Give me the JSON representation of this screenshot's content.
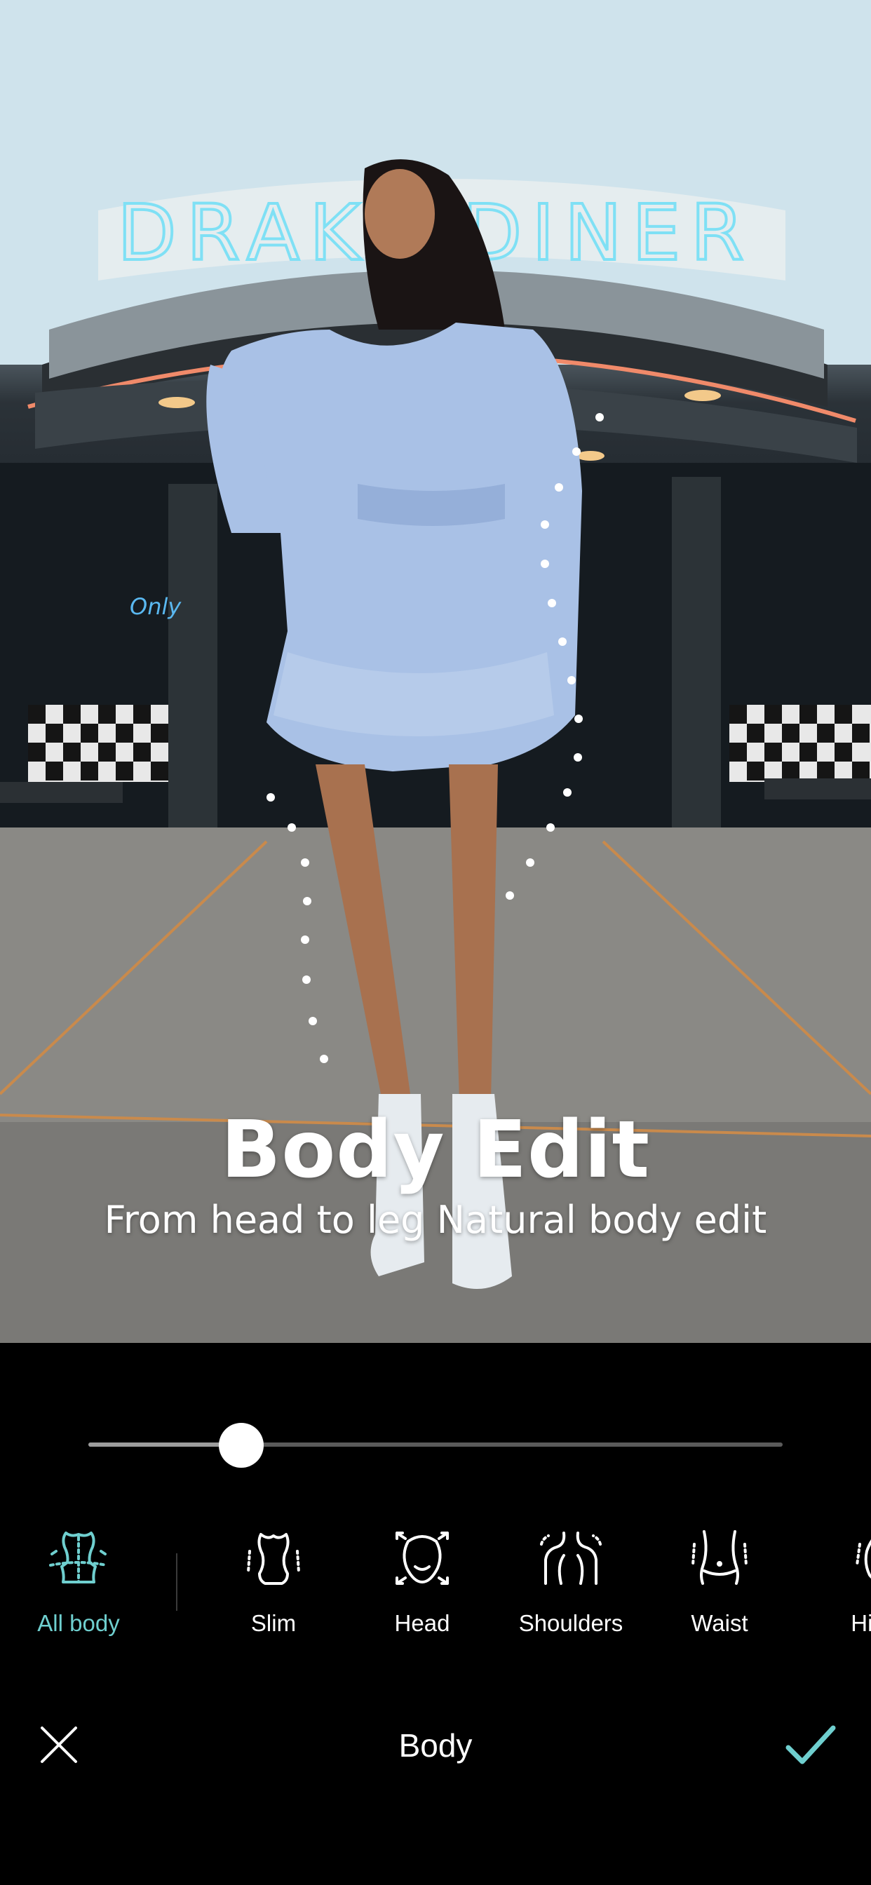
{
  "promo": {
    "title": "Body Edit",
    "subtitle": "From head to leg Natural body edit"
  },
  "photo": {
    "sign_text": "DRAKE DINER",
    "window_sign": "Only"
  },
  "slider": {
    "value": 0.22,
    "accent": "#ffffff"
  },
  "tools": [
    {
      "label": "All body",
      "icon": "torso-icon",
      "active": true
    },
    {
      "label": "Slim",
      "icon": "slim-icon",
      "active": false
    },
    {
      "label": "Head",
      "icon": "head-icon",
      "active": false
    },
    {
      "label": "Shoulders",
      "icon": "shoulders-icon",
      "active": false
    },
    {
      "label": "Waist",
      "icon": "waist-icon",
      "active": false
    },
    {
      "label": "Hip",
      "icon": "hip-icon",
      "active": false
    }
  ],
  "bottom_bar": {
    "title": "Body",
    "close_icon": "close-icon",
    "confirm_icon": "check-icon",
    "accent_color": "#6fcfcf"
  }
}
